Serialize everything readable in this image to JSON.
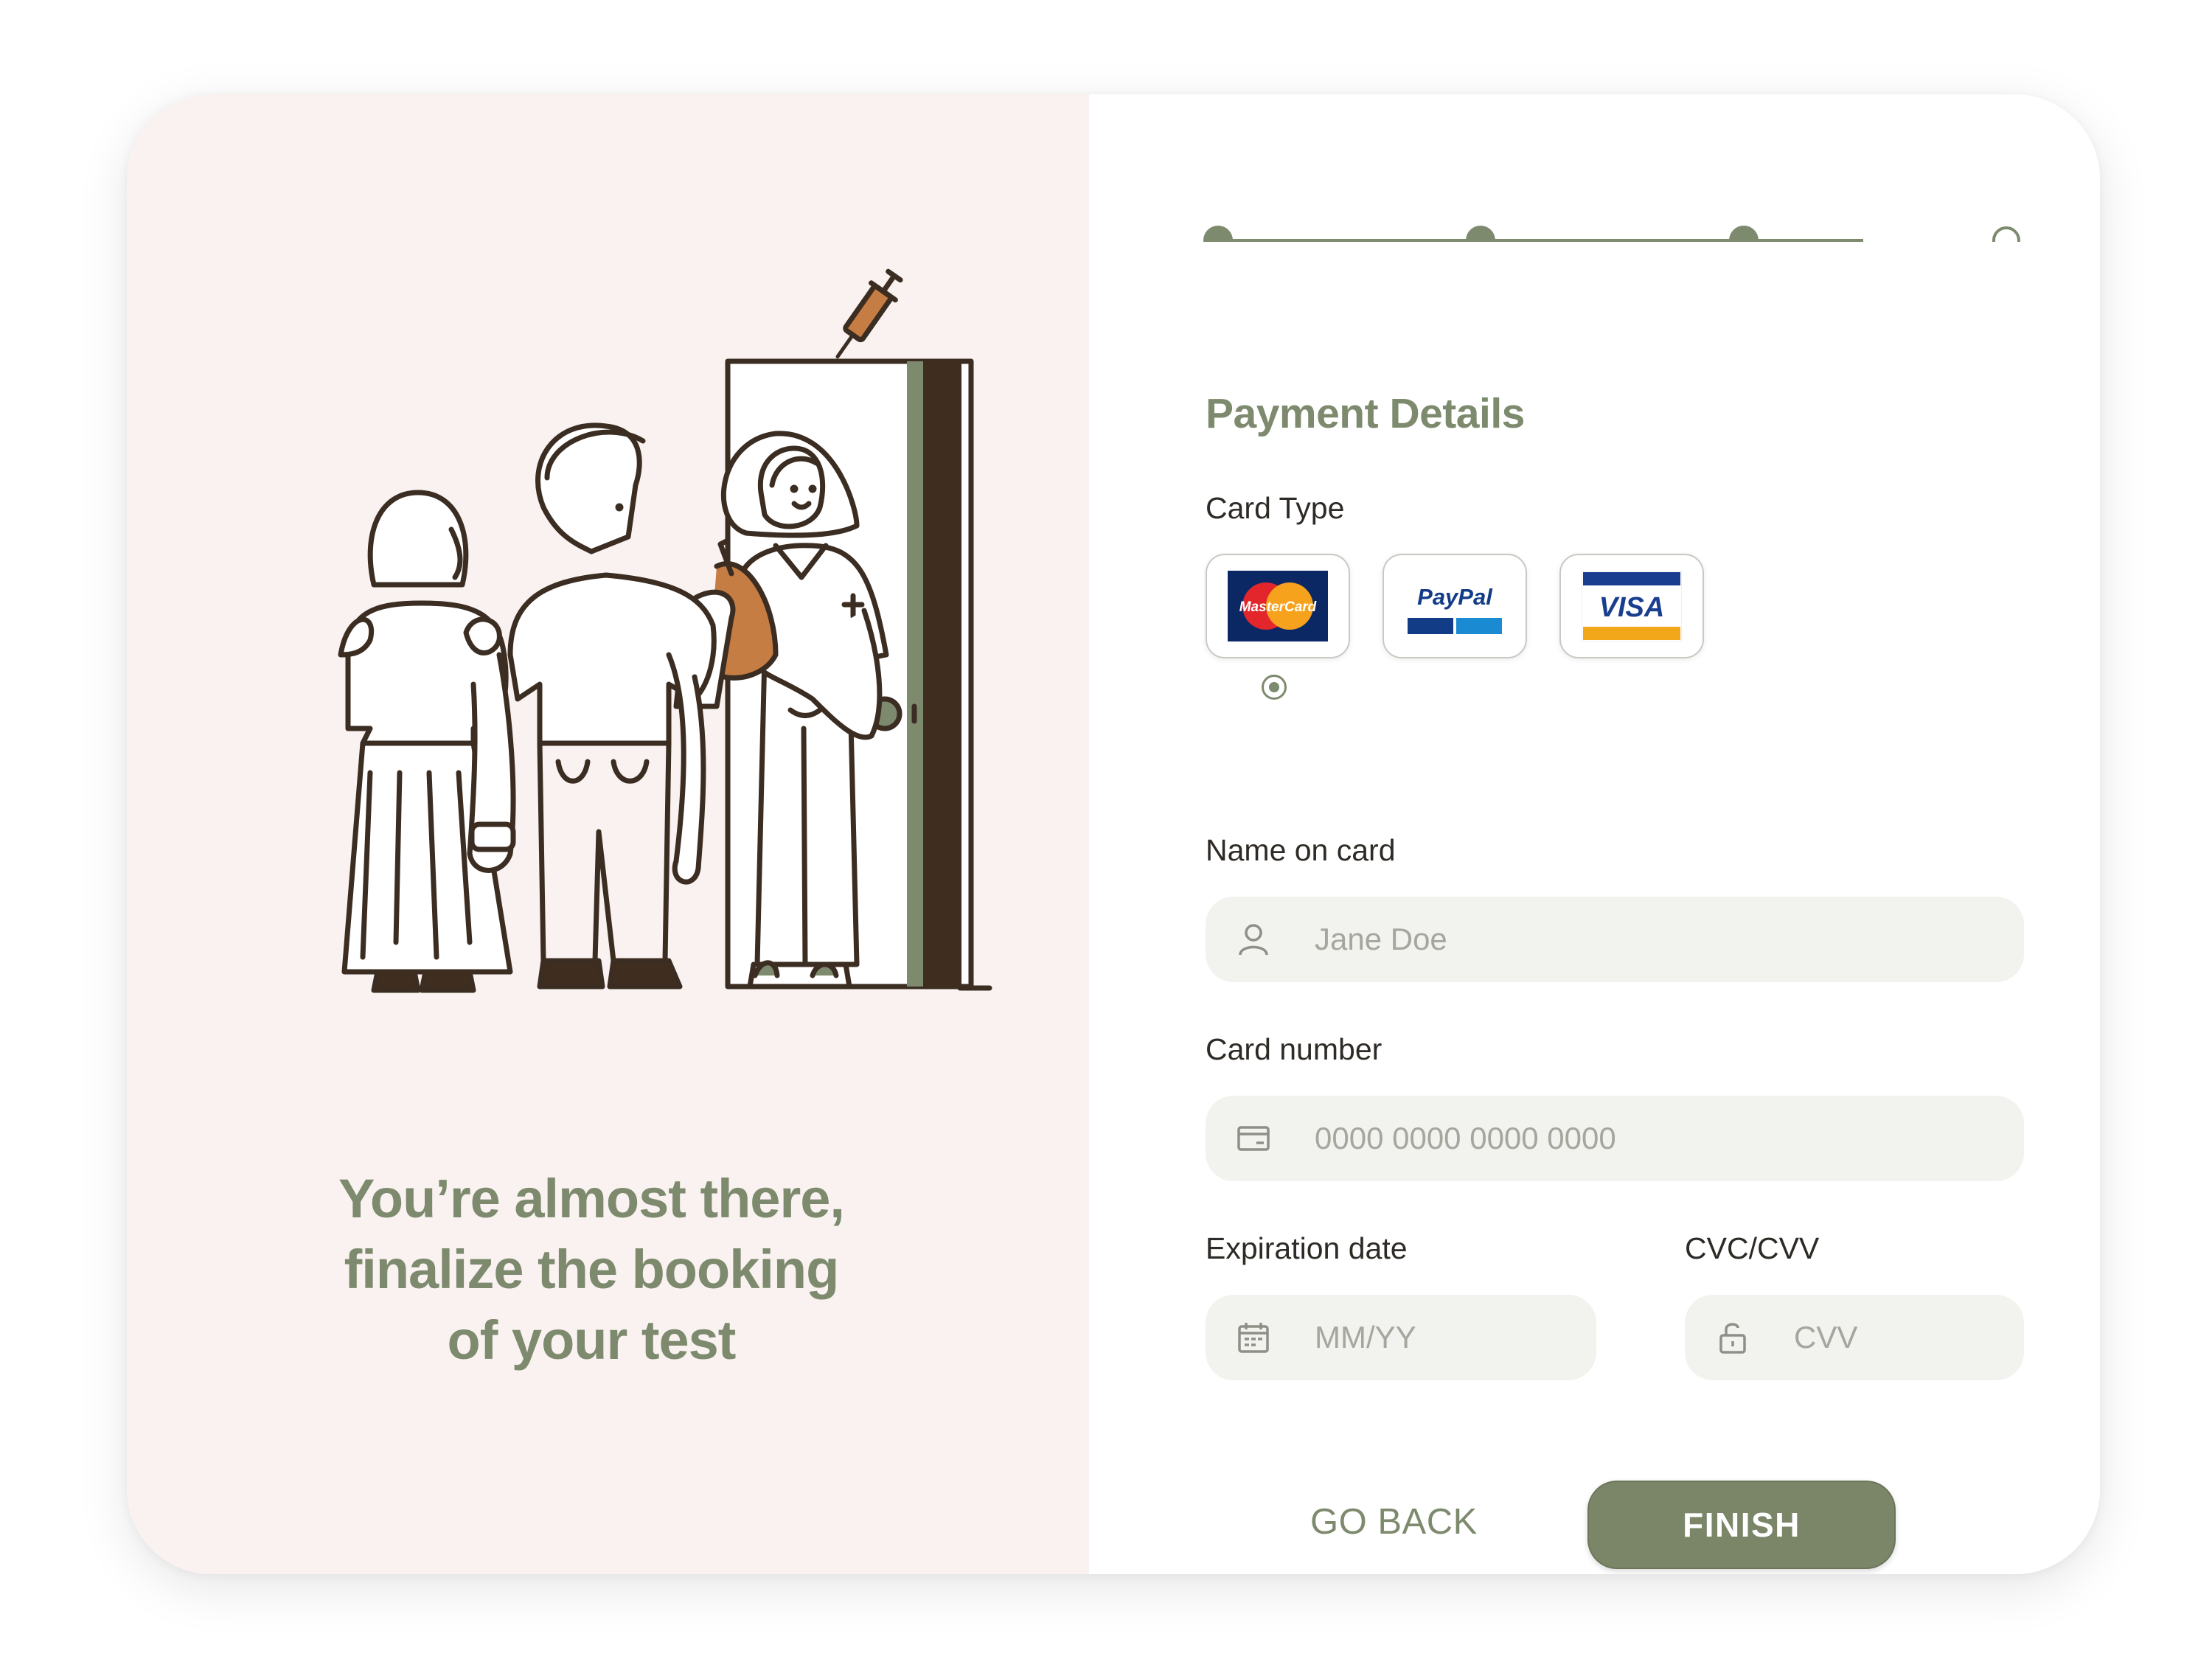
{
  "left_panel": {
    "tagline_lines": [
      "You’re almost there,",
      "finalize the booking",
      "of your test"
    ]
  },
  "stepper": {
    "steps_total": 4,
    "steps_completed": 3
  },
  "payment": {
    "title": "Payment Details",
    "card_type_label": "Card Type",
    "card_options": [
      {
        "icon": "mastercard-logo-icon",
        "brand": "MasterCard",
        "selected": true
      },
      {
        "icon": "paypal-logo-icon",
        "brand": "PayPal",
        "selected": false
      },
      {
        "icon": "visa-logo-icon",
        "brand": "VISA",
        "selected": false
      }
    ],
    "name_label": "Name on card",
    "name_placeholder": "Jane Doe",
    "card_number_label": "Card number",
    "card_number_placeholder": "0000 0000 0000 0000",
    "expiration_label": "Expiration date",
    "expiration_placeholder": "MM/YY",
    "cvc_label": "CVC/CVV",
    "cvc_placeholder": "CVV"
  },
  "actions": {
    "back_label": "GO BACK",
    "finish_label": "FINISH"
  },
  "colors": {
    "accent_green": "#7d8a6d",
    "left_background": "#f9f2f0",
    "field_background": "#f2f2ee",
    "ink": "#3b2d22",
    "syringe_orange": "#c67d43"
  }
}
